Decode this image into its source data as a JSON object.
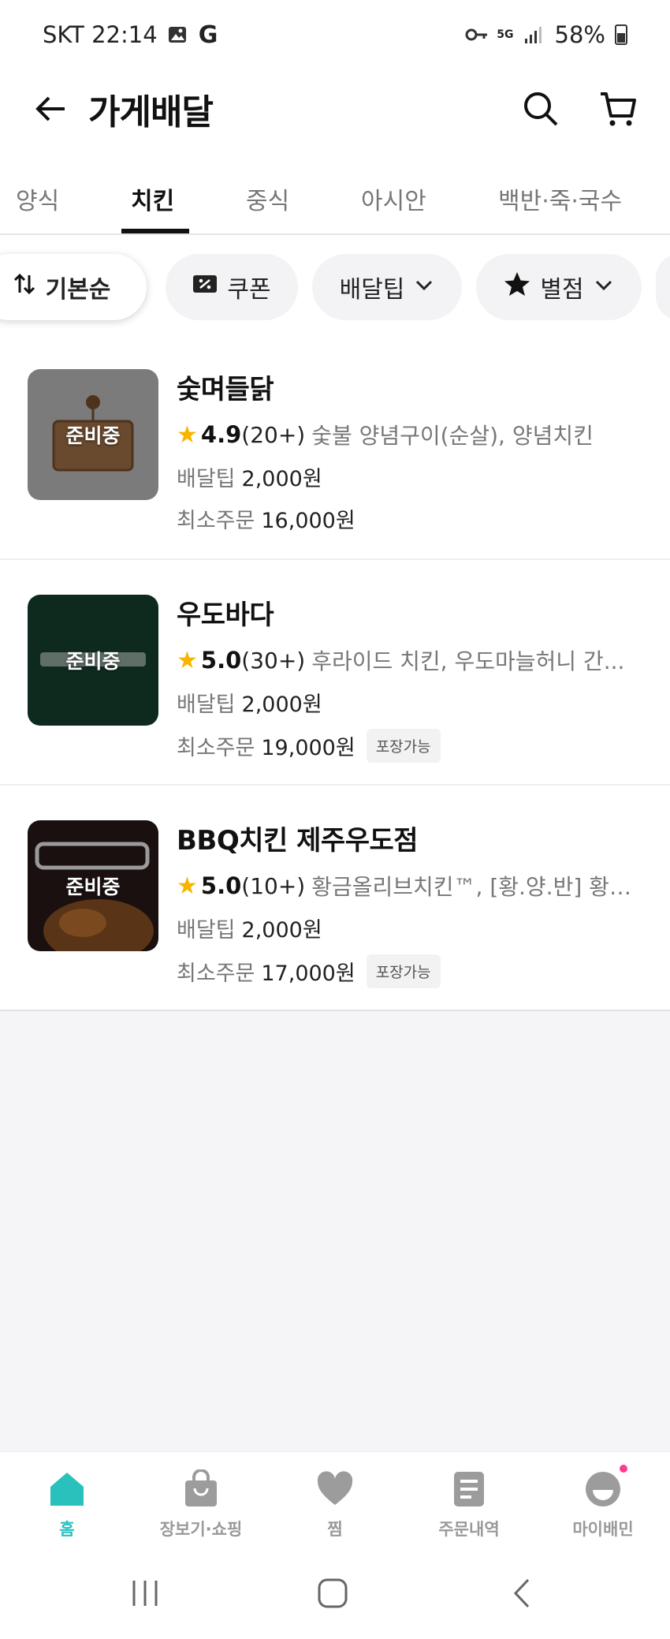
{
  "status_bar": {
    "carrier_time": "SKT 22:14",
    "battery": "58%",
    "network": "5G",
    "icons": [
      "image-icon",
      "google-icon",
      "key-icon",
      "signal-icon",
      "battery-icon"
    ]
  },
  "header": {
    "title": "가게배달",
    "icons": [
      "back-arrow-icon",
      "search-icon",
      "cart-icon"
    ]
  },
  "tabs": [
    {
      "label": "양식"
    },
    {
      "label": "치킨",
      "active": true
    },
    {
      "label": "중식"
    },
    {
      "label": "아시안"
    },
    {
      "label": "백반·죽·국수"
    }
  ],
  "filters": [
    {
      "label": "기본순",
      "icon": "sort-icon"
    },
    {
      "label": "쿠폰",
      "icon": "coupon-icon"
    },
    {
      "label": "배달팁",
      "icon": "chevron-down-icon"
    },
    {
      "label": "별점",
      "icon": "star-icon"
    }
  ],
  "stores": [
    {
      "name": "숯며들닭",
      "status": "준비중",
      "rating": "4.9",
      "review_count": "(20+)",
      "menu": "숯불 양념구이(순살), 양념치킨",
      "delivery_tip_label": "배달팁",
      "delivery_tip": "2,000원",
      "min_order_label": "최소주문",
      "min_order": "16,000원",
      "tag": "",
      "thumb_color": "#7b7b7b"
    },
    {
      "name": "우도바다",
      "status": "준비중",
      "rating": "5.0",
      "review_count": "(30+)",
      "menu": "후라이드 치킨, 우도마늘허니 간...",
      "delivery_tip_label": "배달팁",
      "delivery_tip": "2,000원",
      "min_order_label": "최소주문",
      "min_order": "19,000원",
      "tag": "포장가능",
      "thumb_color": "#0e2a1f"
    },
    {
      "name": "BBQ치킨 제주우도점",
      "status": "준비중",
      "rating": "5.0",
      "review_count": "(10+)",
      "menu": "황금올리브치킨™, [황.양.반] 황올...",
      "delivery_tip_label": "배달팁",
      "delivery_tip": "2,000원",
      "min_order_label": "최소주문",
      "min_order": "17,000원",
      "tag": "포장가능",
      "thumb_color": "#1a1010"
    }
  ],
  "bottom_nav": [
    {
      "label": "홈",
      "icon": "home-icon",
      "active": true
    },
    {
      "label": "장보기·쇼핑",
      "icon": "shopping-bag-icon"
    },
    {
      "label": "찜",
      "icon": "heart-icon"
    },
    {
      "label": "주문내역",
      "icon": "order-list-icon"
    },
    {
      "label": "마이배민",
      "icon": "my-profile-icon"
    }
  ],
  "colors": {
    "accent": "#2ac1bc",
    "star": "#f7b500",
    "notification_dot": "#ff3b8d"
  }
}
